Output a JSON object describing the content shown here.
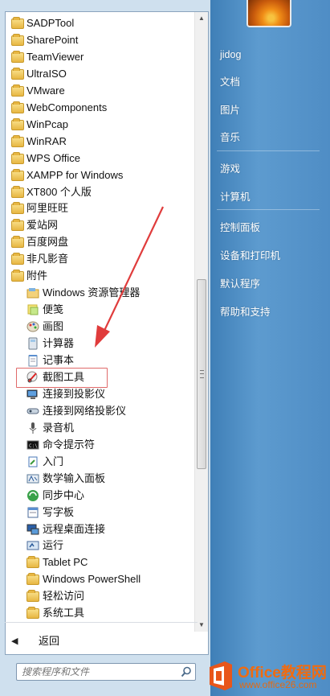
{
  "programs": [
    {
      "kind": "folder",
      "label": "SADPTool"
    },
    {
      "kind": "folder",
      "label": "SharePoint"
    },
    {
      "kind": "folder",
      "label": "TeamViewer"
    },
    {
      "kind": "folder",
      "label": "UltraISO"
    },
    {
      "kind": "folder",
      "label": "VMware"
    },
    {
      "kind": "folder",
      "label": "WebComponents"
    },
    {
      "kind": "folder",
      "label": "WinPcap"
    },
    {
      "kind": "folder",
      "label": "WinRAR"
    },
    {
      "kind": "folder",
      "label": "WPS Office"
    },
    {
      "kind": "folder",
      "label": "XAMPP for Windows"
    },
    {
      "kind": "folder",
      "label": "XT800 个人版"
    },
    {
      "kind": "folder",
      "label": "阿里旺旺"
    },
    {
      "kind": "folder",
      "label": "爱站网"
    },
    {
      "kind": "folder",
      "label": "百度网盘"
    },
    {
      "kind": "folder",
      "label": "非凡影音"
    },
    {
      "kind": "folder",
      "label": "附件"
    }
  ],
  "accessories": [
    {
      "icon": "explorer-icon",
      "label": "Windows 资源管理器"
    },
    {
      "icon": "sticky-notes-icon",
      "label": "便笺"
    },
    {
      "icon": "paint-icon",
      "label": "画图"
    },
    {
      "icon": "calculator-icon",
      "label": "计算器"
    },
    {
      "icon": "notepad-icon",
      "label": "记事本"
    },
    {
      "icon": "snipping-tool-icon",
      "label": "截图工具"
    },
    {
      "icon": "projector-icon",
      "label": "连接到投影仪"
    },
    {
      "icon": "network-projector-icon",
      "label": "连接到网络投影仪"
    },
    {
      "icon": "microphone-icon",
      "label": "录音机"
    },
    {
      "icon": "cmd-icon",
      "label": "命令提示符"
    },
    {
      "icon": "getting-started-icon",
      "label": "入门"
    },
    {
      "icon": "math-input-icon",
      "label": "数学输入面板"
    },
    {
      "icon": "sync-center-icon",
      "label": "同步中心"
    },
    {
      "icon": "wordpad-icon",
      "label": "写字板"
    },
    {
      "icon": "remote-desktop-icon",
      "label": "远程桌面连接"
    },
    {
      "icon": "run-icon",
      "label": "运行"
    }
  ],
  "subfolders": [
    {
      "label": "Tablet PC"
    },
    {
      "label": "Windows PowerShell"
    },
    {
      "label": "轻松访问"
    },
    {
      "label": "系统工具"
    }
  ],
  "back_label": "返回",
  "search": {
    "placeholder": "搜索程序和文件"
  },
  "right_panel": [
    {
      "label": "jidog"
    },
    {
      "label": "文档"
    },
    {
      "label": "图片"
    },
    {
      "label": "音乐"
    },
    {
      "label": "游戏"
    },
    {
      "label": "计算机"
    },
    {
      "label": "控制面板"
    },
    {
      "label": "设备和打印机"
    },
    {
      "label": "默认程序"
    },
    {
      "label": "帮助和支持"
    }
  ],
  "watermark": {
    "title": "Office教程网",
    "url": "www.office26.com"
  },
  "colors": {
    "accent_blue": "#4f8dc5",
    "highlight_red": "#e06a6a",
    "arrow_red": "#e03c3c",
    "watermark_orange": "#f06b10"
  }
}
